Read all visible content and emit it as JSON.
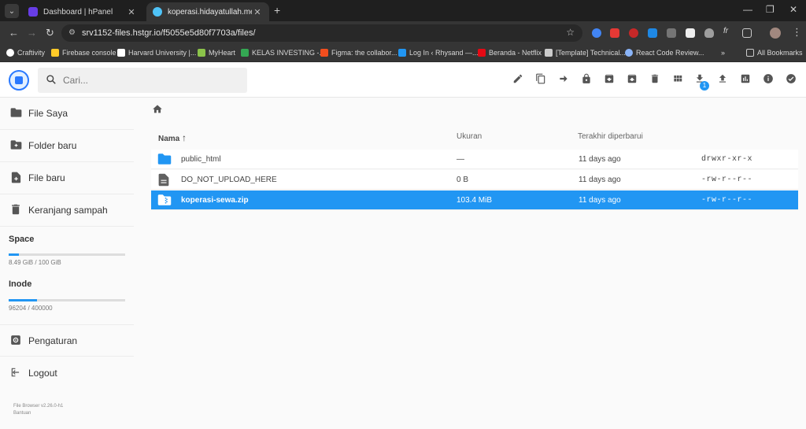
{
  "browser": {
    "tabs": [
      {
        "title": "Dashboard | hPanel",
        "fav_color": "#673de6"
      },
      {
        "title": "koperasi.hidayatullah.me - kop",
        "fav_color": "#4fc3f7"
      }
    ],
    "url": "srv1152-files.hstgr.io/f5055e5d80f7703a/files/",
    "bookmarks": [
      {
        "label": "Craftivity",
        "color": "#ffffff"
      },
      {
        "label": "Firebase console",
        "color": "#ffca28"
      },
      {
        "label": "Harvard University |...",
        "color": "#ffffff"
      },
      {
        "label": "MyHeart",
        "color": "#8bc34a"
      },
      {
        "label": "KELAS INVESTING -...",
        "color": "#34a853"
      },
      {
        "label": "Figma: the collabor...",
        "color": "#f24e1e"
      },
      {
        "label": "Log In ‹ Rhysand —...",
        "color": "#2196f3"
      },
      {
        "label": "Beranda - Netflix",
        "color": "#e50914"
      },
      {
        "label": "[Template] Technical...",
        "color": "#cccccc"
      },
      {
        "label": "React Code Review...",
        "color": "#8ab4f8"
      }
    ],
    "all_bookmarks": "All Bookmarks"
  },
  "header": {
    "search_placeholder": "Cari...",
    "download_badge": "1"
  },
  "sidebar": {
    "items": [
      {
        "label": "File Saya"
      },
      {
        "label": "Folder baru"
      },
      {
        "label": "File baru"
      },
      {
        "label": "Keranjang sampah"
      }
    ],
    "space": {
      "title": "Space",
      "value": "8.49 GiB / 100 GiB",
      "fraction": 0.0849
    },
    "inode": {
      "title": "Inode",
      "value": "96204 / 400000",
      "fraction": 0.2405
    },
    "bottom_items": [
      {
        "label": "Pengaturan"
      },
      {
        "label": "Logout"
      }
    ],
    "version": "File Browser v2.26.0-h1",
    "help": "Bantuan"
  },
  "list": {
    "columns": {
      "name": "Nama",
      "size": "Ukuran",
      "modified": "Terakhir diperbarui"
    },
    "rows": [
      {
        "name": "public_html",
        "size": "—",
        "modified": "11 days ago",
        "perms": "drwxr-xr-x"
      },
      {
        "name": "DO_NOT_UPLOAD_HERE",
        "size": "0 B",
        "modified": "11 days ago",
        "perms": "-rw-r--r--"
      },
      {
        "name": "koperasi-sewa.zip",
        "size": "103.4 MiB",
        "modified": "11 days ago",
        "perms": "-rw-r--r--"
      }
    ]
  },
  "colors": {
    "accent": "#2196f3",
    "folder": "#2196f3"
  }
}
